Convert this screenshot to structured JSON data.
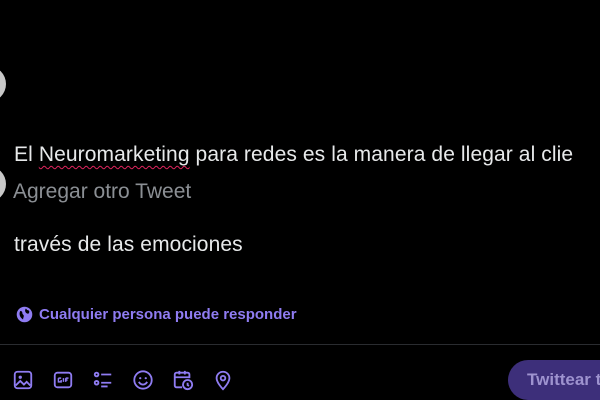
{
  "thread": {
    "tweet1": {
      "line1_prefix": "El ",
      "line1_misspelled": "Neuromarketing",
      "line1_suffix": " para redes es la manera de llegar al clie",
      "line2": "través de las emociones"
    },
    "add_tweet_placeholder": "Agregar otro Tweet"
  },
  "reply_setting": {
    "label": "Cualquier persona puede responder",
    "icon": "globe-icon"
  },
  "toolbar": {
    "tools": [
      "image-icon",
      "gif-icon",
      "poll-icon",
      "emoji-icon",
      "schedule-icon",
      "location-icon"
    ],
    "tweet_button_label": "Twittear t"
  },
  "colors": {
    "background": "#000000",
    "text": "#e7e9ea",
    "placeholder": "#8b8f94",
    "accent": "#8f7cf2",
    "button_bg": "#3d2f7a",
    "button_text": "#9e93cf",
    "spellcheck": "#e0245e"
  }
}
